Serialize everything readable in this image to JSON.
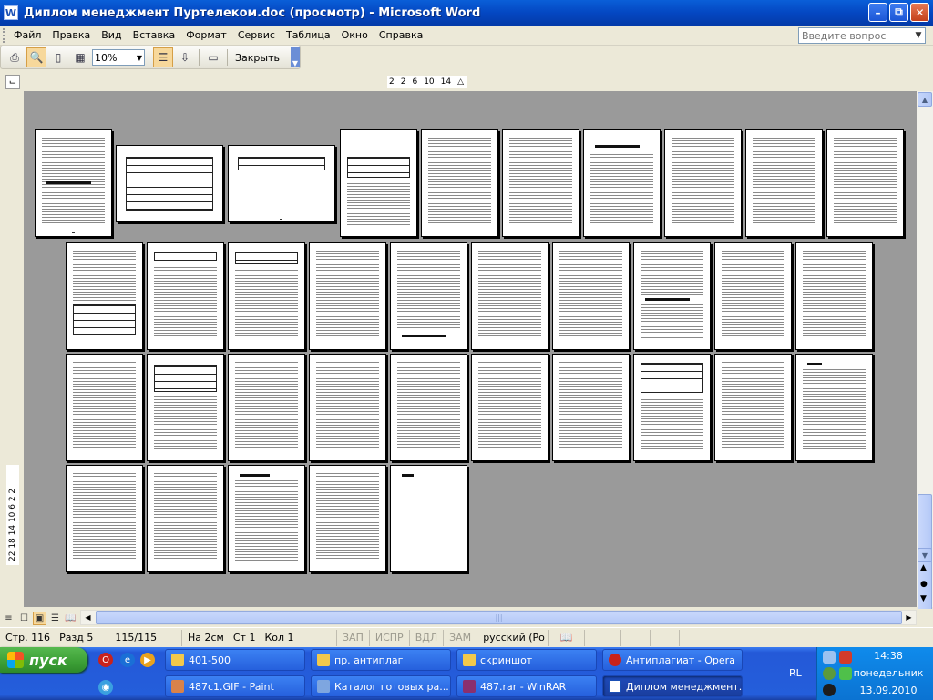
{
  "window": {
    "title": "Диплом менеджмент Пуртелеком.doc (просмотр) - Microsoft Word"
  },
  "menu": {
    "items": [
      "Файл",
      "Правка",
      "Вид",
      "Вставка",
      "Формат",
      "Сервис",
      "Таблица",
      "Окно",
      "Справка"
    ],
    "help_placeholder": "Введите вопрос"
  },
  "toolbar": {
    "zoom": "10%",
    "close_label": "Закрыть"
  },
  "ruler": {
    "horizontal": [
      "2",
      "2",
      "6",
      "10",
      "14"
    ],
    "vertical": "22 18 14 10 6 2 2"
  },
  "status": {
    "page": "Стр. 116",
    "section": "Разд 5",
    "pages": "115/115",
    "position": "На 2см",
    "line": "Ст 1",
    "column": "Кол 1",
    "rec": "ЗАП",
    "trk": "ИСПР",
    "ext": "ВДЛ",
    "ovr": "ЗАМ",
    "language": "русский (Ро"
  },
  "taskbar": {
    "start_label": "пуск",
    "tasks_row1": [
      "401-500",
      "пр. антиплаг",
      "скриншот",
      "Антиплагиат - Opera"
    ],
    "tasks_row2": [
      "487c1.GIF - Paint",
      "Каталог готовых ра...",
      "487.rar - WinRAR",
      "Диплом менеджмент..."
    ],
    "language_indicator": "RL",
    "clock_time": "14:38",
    "clock_day": "понедельник",
    "clock_date": "13.09.2010"
  },
  "colors": {
    "titlebar": "#0447c2",
    "workspace": "#9a9a9a",
    "taskbar": "#245edb",
    "start": "#3c9f36"
  }
}
